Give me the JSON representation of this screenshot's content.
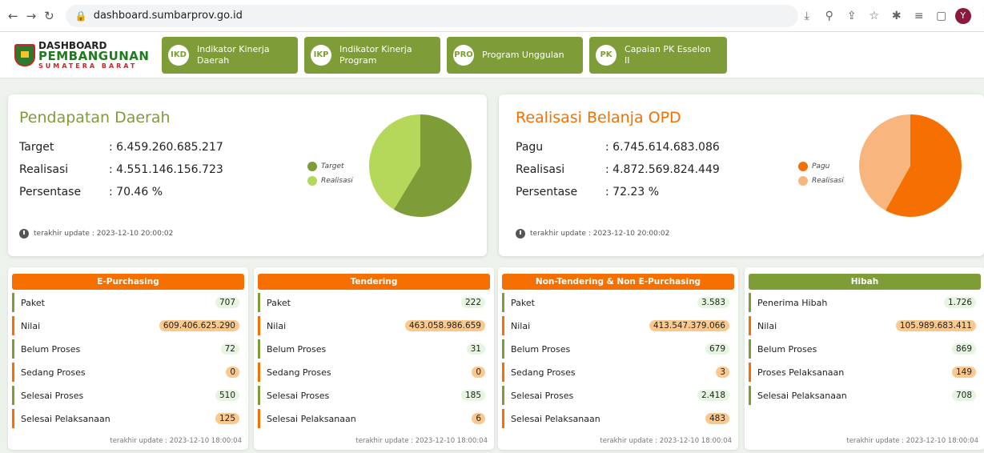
{
  "browser": {
    "url": "dashboard.sumbarprov.go.id",
    "avatar": "Y"
  },
  "logo": {
    "line1": "DASHBOARD",
    "line2": "PEMBANGUNAN",
    "line3": "SUMATERA BARAT"
  },
  "nav": [
    {
      "badge": "IKD",
      "label": "Indikator Kinerja Daerah"
    },
    {
      "badge": "IKP",
      "label": "Indikator Kinerja Program"
    },
    {
      "badge": "PRO",
      "label": "Program Unggulan"
    },
    {
      "badge": "PK",
      "label": "Capaian PK Esselon II"
    }
  ],
  "pendapatan": {
    "title": "Pendapatan Daerah",
    "rows": [
      {
        "label": "Target",
        "value": ": 6.459.260.685.217"
      },
      {
        "label": "Realisasi",
        "value": ": 4.551.146.156.723"
      },
      {
        "label": "Persentase",
        "value": ": 70.46 %"
      }
    ],
    "update": "terakhir update : 2023-12-10 20:00:02",
    "legend": [
      "Target",
      "Realisasi"
    ],
    "colors": [
      "#7e9c38",
      "#b5d85a"
    ],
    "pie_values": [
      6459260685217,
      4551146156723
    ]
  },
  "belanja": {
    "title": "Realisasi Belanja OPD",
    "rows": [
      {
        "label": "Pagu",
        "value": ": 6.745.614.683.086"
      },
      {
        "label": "Realisasi",
        "value": ": 4.872.569.824.449"
      },
      {
        "label": "Persentase",
        "value": ": 72.23 %"
      }
    ],
    "update": "terakhir update : 2023-12-10 20:00:02",
    "legend": [
      "Pagu",
      "Realisasi"
    ],
    "colors": [
      "#f57000",
      "#f8b67e"
    ],
    "pie_values": [
      6745614683086,
      4872569824449
    ]
  },
  "cards": [
    {
      "title": "E-Purchasing",
      "head_color": "#f57000",
      "rows": [
        {
          "label": "Paket",
          "value": "707",
          "color": "green"
        },
        {
          "label": "Nilai",
          "value": "609.406.625.290",
          "color": "orange"
        },
        {
          "label": "Belum Proses",
          "value": "72",
          "color": "green"
        },
        {
          "label": "Sedang Proses",
          "value": "0",
          "color": "orange"
        },
        {
          "label": "Selesai Proses",
          "value": "510",
          "color": "green"
        },
        {
          "label": "Selesai Pelaksanaan",
          "value": "125",
          "color": "orange"
        }
      ],
      "update": "terakhir update : 2023-12-10 18:00:04"
    },
    {
      "title": "Tendering",
      "head_color": "#f57000",
      "rows": [
        {
          "label": "Paket",
          "value": "222",
          "color": "green"
        },
        {
          "label": "Nilai",
          "value": "463.058.986.659",
          "color": "orange"
        },
        {
          "label": "Belum Proses",
          "value": "31",
          "color": "green"
        },
        {
          "label": "Sedang Proses",
          "value": "0",
          "color": "orange"
        },
        {
          "label": "Selesai Proses",
          "value": "185",
          "color": "green"
        },
        {
          "label": "Selesai Pelaksanaan",
          "value": "6",
          "color": "orange"
        }
      ],
      "update": "terakhir update : 2023-12-10 18:00:04"
    },
    {
      "title": "Non-Tendering & Non E-Purchasing",
      "head_color": "#f57000",
      "rows": [
        {
          "label": "Paket",
          "value": "3.583",
          "color": "green"
        },
        {
          "label": "Nilai",
          "value": "413.547.379.066",
          "color": "orange"
        },
        {
          "label": "Belum Proses",
          "value": "679",
          "color": "green"
        },
        {
          "label": "Sedang Proses",
          "value": "3",
          "color": "orange"
        },
        {
          "label": "Selesai Proses",
          "value": "2.418",
          "color": "green"
        },
        {
          "label": "Selesai Pelaksanaan",
          "value": "483",
          "color": "orange"
        }
      ],
      "update": "terakhir update : 2023-12-10 18:00:04"
    },
    {
      "title": "Hibah",
      "head_color": "#7e9c38",
      "rows": [
        {
          "label": "Penerima Hibah",
          "value": "1.726",
          "color": "green"
        },
        {
          "label": "Nilai",
          "value": "105.989.683.411",
          "color": "orange"
        },
        {
          "label": "Belum Proses",
          "value": "869",
          "color": "green"
        },
        {
          "label": "Proses Pelaksanaan",
          "value": "149",
          "color": "orange"
        },
        {
          "label": "Selesai Pelaksanaan",
          "value": "708",
          "color": "green"
        }
      ],
      "update": "terakhir update : 2023-12-10 18:00:04"
    }
  ]
}
